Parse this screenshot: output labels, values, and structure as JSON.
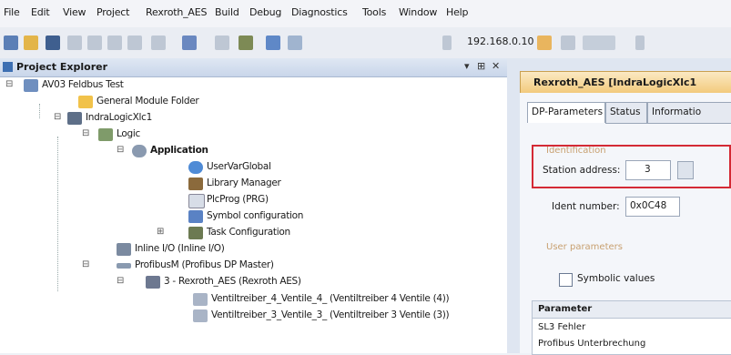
{
  "menu": [
    "File",
    "Edit",
    "View",
    "Project",
    "Rexroth_AES",
    "Build",
    "Debug",
    "Diagnostics",
    "Tools",
    "Window",
    "Help"
  ],
  "toolbar": {
    "ip_address": "192.168.0.10"
  },
  "explorer": {
    "title": "Project Explorer",
    "controls": [
      "▾",
      "⊞",
      "✕"
    ],
    "tree": [
      "AV03 Feldbus Test",
      "General Module Folder",
      "IndraLogicXlc1",
      "Logic",
      "Application",
      "UserVarGlobal",
      "Library Manager",
      "PlcProg (PRG)",
      "Symbol configuration",
      "Task Configuration",
      "Inline I/O (Inline I/O)",
      "ProfibusM (Profibus DP Master)",
      "3 - Rexroth_AES (Rexroth AES)",
      "Ventiltreiber_4_Ventile_4_ (Ventiltreiber 4 Ventile (4))",
      "Ventiltreiber_3_Ventile_3_ (Ventiltreiber 3 Ventile (3))"
    ]
  },
  "editor": {
    "title": "Rexroth_AES [IndraLogicXlc1",
    "tabs": [
      "DP-Parameters",
      "Status",
      "Informatio"
    ],
    "identification_label": "Identification",
    "station_address_label": "Station address:",
    "station_address_value": "3",
    "ident_number_label": "Ident number:",
    "ident_number_value": "0x0C48",
    "user_parameters_label": "User parameters",
    "symbolic_values_label": "Symbolic values",
    "param_header": "Parameter",
    "param_rows": [
      "SL3 Fehler",
      "Profibus Unterbrechung"
    ]
  }
}
